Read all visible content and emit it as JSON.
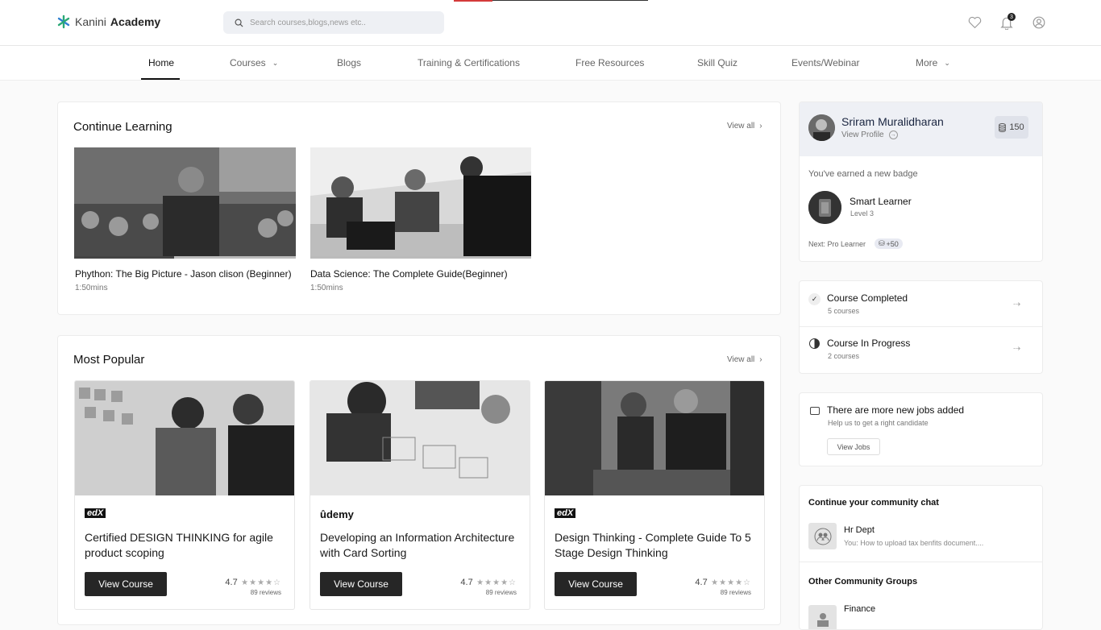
{
  "header": {
    "logo_light": "Kanini",
    "logo_bold": "Academy",
    "search_placeholder": "Search courses,blogs,news etc..",
    "notification_count": "3"
  },
  "nav": {
    "items": [
      {
        "label": "Home",
        "active": true
      },
      {
        "label": "Courses",
        "dropdown": true
      },
      {
        "label": "Blogs"
      },
      {
        "label": "Training & Certifications"
      },
      {
        "label": "Free Resources"
      },
      {
        "label": "Skill Quiz"
      },
      {
        "label": "Events/Webinar"
      },
      {
        "label": "More",
        "dropdown": true
      }
    ]
  },
  "continue_learning": {
    "title": "Continue Learning",
    "view_all": "View all",
    "courses": [
      {
        "title": "Phython: The Big Picture - Jason clison (Beginner)",
        "duration": "1:50mins",
        "progress": 0.45
      },
      {
        "title": "Data Science: The Complete Guide(Beginner)",
        "duration": "1:50mins",
        "progress": 0.0
      }
    ]
  },
  "most_popular": {
    "title": "Most Popular",
    "view_all": "View all",
    "courses": [
      {
        "provider": "edX",
        "title": "Certified DESIGN THINKING for agile product scoping",
        "button": "View Course",
        "rating": "4.7",
        "stars": "★★★★☆",
        "reviews": "89 reviews"
      },
      {
        "provider": "ûdemy",
        "title": "Developing an Information Architecture with Card Sorting",
        "button": "View Course",
        "rating": "4.7",
        "stars": "★★★★☆",
        "reviews": "89 reviews"
      },
      {
        "provider": "edX",
        "title": "Design Thinking - Complete Guide To 5 Stage Design Thinking",
        "button": "View Course",
        "rating": "4.7",
        "stars": "★★★★☆",
        "reviews": "89 reviews"
      }
    ]
  },
  "profile": {
    "name": "Sriram Muralidharan",
    "view_profile": "View Profile",
    "coins": "150",
    "badge_heading": "You've earned a new badge",
    "badge_name": "Smart Learner",
    "badge_level": "Level 3",
    "next_label": "Next: Pro Learner",
    "next_points": "+50"
  },
  "progress": {
    "completed_title": "Course Completed",
    "completed_count": "5 courses",
    "inprogress_title": "Course In Progress",
    "inprogress_count": "2 courses"
  },
  "jobs": {
    "title": "There are more new jobs added",
    "subtitle": "Help us to get a right candidate",
    "button": "View Jobs"
  },
  "community": {
    "title": "Continue your community chat",
    "chat_name": "Hr Dept",
    "chat_preview": "You: How to upload tax benfits document....",
    "other_title": "Other Community Groups",
    "other_group": "Finance"
  },
  "colors": {
    "accent": "#262626",
    "search_bg": "#eef0f4",
    "profile_bg": "#eef0f5",
    "logo_green": "#2aa876",
    "logo_blue": "#2f7fd1"
  }
}
